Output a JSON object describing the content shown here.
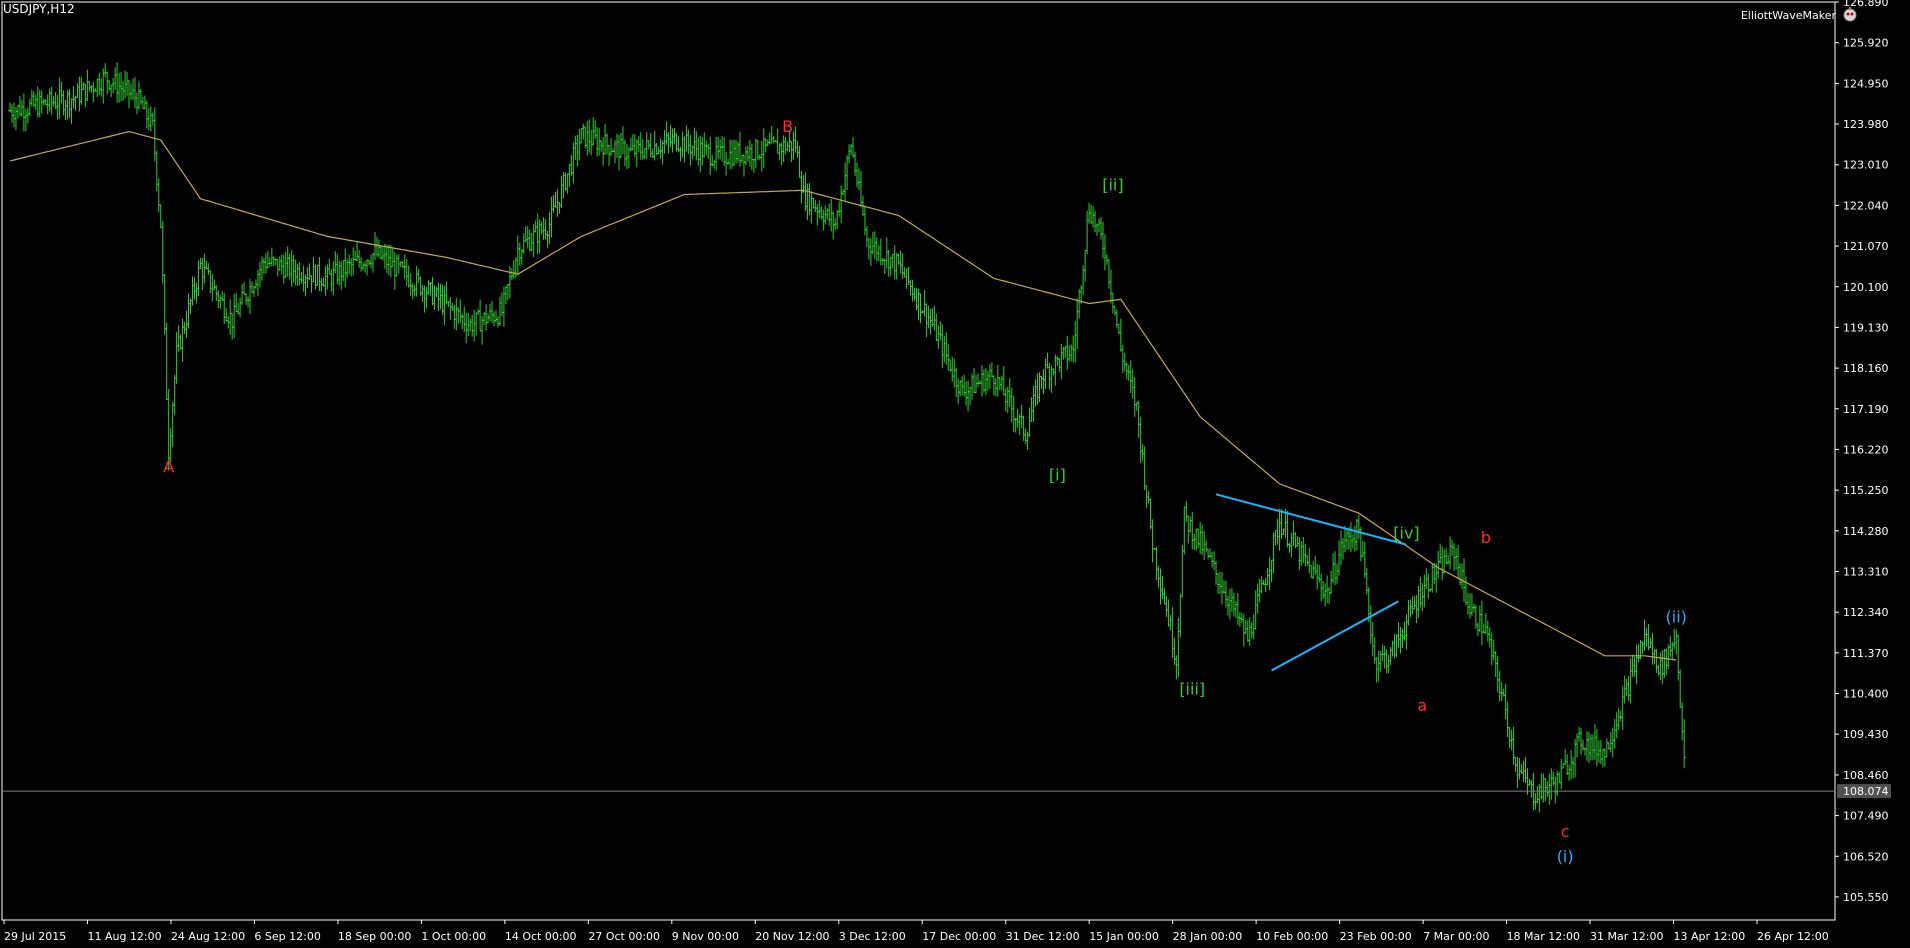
{
  "header": {
    "symbol_label": "USDJPY,H12",
    "indicator_label": "ElliottWaveMaker",
    "indicator_icon": "robot-icon"
  },
  "colors": {
    "background": "#000000",
    "bars": "#32cd32",
    "moving_average": "#c8a850",
    "triangle": "#19b4ff",
    "label_red": "#ff2b2b",
    "label_green": "#32cd32",
    "label_blue": "#19b4ff",
    "axis": "#ffffff",
    "price_line": "#808080"
  },
  "chart_data": {
    "type": "ohlc",
    "timeframe": "H12",
    "ylim": [
      105.0,
      126.89
    ],
    "y_ticks": [
      "126.890",
      "125.920",
      "124.950",
      "123.980",
      "123.010",
      "122.040",
      "121.070",
      "120.100",
      "119.130",
      "118.160",
      "117.190",
      "116.220",
      "115.250",
      "114.280",
      "113.310",
      "112.340",
      "111.370",
      "110.400",
      "109.430",
      "108.460",
      "107.490",
      "106.520",
      "105.550"
    ],
    "x_ticks": [
      "29 Jul 2015",
      "11 Aug 12:00",
      "24 Aug 12:00",
      "6 Sep 12:00",
      "18 Sep 00:00",
      "1 Oct 00:00",
      "14 Oct 00:00",
      "27 Oct 00:00",
      "9 Nov 00:00",
      "20 Nov 12:00",
      "3 Dec 12:00",
      "17 Dec 00:00",
      "31 Dec 12:00",
      "15 Jan 00:00",
      "28 Jan 00:00",
      "10 Feb 00:00",
      "23 Feb 00:00",
      "7 Mar 00:00",
      "18 Mar 12:00",
      "31 Mar 12:00",
      "13 Apr 12:00",
      "26 Apr 12:00"
    ],
    "bar_count": 230,
    "price_path": [
      [
        0,
        124.3
      ],
      [
        8,
        124.6
      ],
      [
        12,
        125.1
      ],
      [
        16,
        124.6
      ],
      [
        18,
        123.9
      ],
      [
        19,
        121.6
      ],
      [
        20,
        116.2
      ],
      [
        21,
        118.5
      ],
      [
        24,
        120.6
      ],
      [
        28,
        119.3
      ],
      [
        32,
        120.7
      ],
      [
        40,
        120.3
      ],
      [
        46,
        120.9
      ],
      [
        52,
        120.1
      ],
      [
        58,
        119.2
      ],
      [
        62,
        119.5
      ],
      [
        64,
        121.0
      ],
      [
        68,
        121.6
      ],
      [
        72,
        123.7
      ],
      [
        78,
        123.3
      ],
      [
        84,
        123.6
      ],
      [
        89,
        123.2
      ],
      [
        96,
        123.4
      ],
      [
        99,
        123.5
      ],
      [
        100,
        122.3
      ],
      [
        104,
        121.6
      ],
      [
        106,
        123.5
      ],
      [
        108,
        121.2
      ],
      [
        112,
        120.6
      ],
      [
        116,
        119.3
      ],
      [
        120,
        117.6
      ],
      [
        124,
        118.0
      ],
      [
        128,
        116.6
      ],
      [
        130,
        118.0
      ],
      [
        134,
        118.6
      ],
      [
        136,
        122.0
      ],
      [
        138,
        121.0
      ],
      [
        140,
        118.6
      ],
      [
        142,
        117.2
      ],
      [
        144,
        114.0
      ],
      [
        146,
        112.2
      ],
      [
        147,
        111.2
      ],
      [
        148,
        114.6
      ],
      [
        150,
        114.0
      ],
      [
        154,
        112.5
      ],
      [
        156,
        111.7
      ],
      [
        158,
        113.0
      ],
      [
        160,
        114.5
      ],
      [
        163,
        113.6
      ],
      [
        166,
        112.8
      ],
      [
        168,
        114.0
      ],
      [
        170,
        114.3
      ],
      [
        172,
        111.2
      ],
      [
        174,
        111.3
      ],
      [
        178,
        112.9
      ],
      [
        182,
        113.8
      ],
      [
        184,
        112.4
      ],
      [
        186,
        111.9
      ],
      [
        188,
        110.4
      ],
      [
        190,
        108.6
      ],
      [
        192,
        108.0
      ],
      [
        195,
        108.3
      ],
      [
        198,
        109.3
      ],
      [
        201,
        109.0
      ],
      [
        204,
        110.6
      ],
      [
        206,
        111.8
      ],
      [
        208,
        111.0
      ],
      [
        210,
        111.8
      ],
      [
        211,
        108.7
      ]
    ],
    "series": [
      {
        "kind": "moving_average",
        "points": [
          [
            0,
            123.1
          ],
          [
            15,
            123.8
          ],
          [
            19,
            123.6
          ],
          [
            24,
            122.2
          ],
          [
            40,
            121.3
          ],
          [
            55,
            120.8
          ],
          [
            64,
            120.4
          ],
          [
            72,
            121.3
          ],
          [
            85,
            122.3
          ],
          [
            100,
            122.4
          ],
          [
            112,
            121.8
          ],
          [
            124,
            120.3
          ],
          [
            136,
            119.7
          ],
          [
            140,
            119.8
          ],
          [
            150,
            117.0
          ],
          [
            160,
            115.4
          ],
          [
            170,
            114.7
          ],
          [
            180,
            113.4
          ],
          [
            190,
            112.4
          ],
          [
            201,
            111.3
          ],
          [
            206,
            111.3
          ],
          [
            210,
            111.2
          ]
        ]
      }
    ],
    "current_price": "108.074",
    "wave_labels": [
      {
        "text": "A",
        "bar": 20,
        "price": 116.3,
        "color": "label_red",
        "placement": "below"
      },
      {
        "text": "B",
        "bar": 98,
        "price": 123.7,
        "color": "label_red",
        "placement": "above"
      },
      {
        "text": "[i]",
        "bar": 132,
        "price": 116.1,
        "color": "label_green",
        "placement": "below"
      },
      {
        "text": "[ii]",
        "bar": 139,
        "price": 122.3,
        "color": "label_green",
        "placement": "above"
      },
      {
        "text": "[iii]",
        "bar": 149,
        "price": 111.0,
        "color": "label_green",
        "placement": "below"
      },
      {
        "text": "[iv]",
        "bar": 176,
        "price": 114.0,
        "color": "label_green",
        "placement": "above"
      },
      {
        "text": "a",
        "bar": 178,
        "price": 110.6,
        "color": "label_red",
        "placement": "below"
      },
      {
        "text": "b",
        "bar": 186,
        "price": 113.9,
        "color": "label_red",
        "placement": "above"
      },
      {
        "text": "c",
        "bar": 196,
        "price": 107.6,
        "color": "label_red",
        "placement": "below"
      },
      {
        "text": "(i)",
        "bar": 196,
        "price": 107.0,
        "color": "label_blue",
        "placement": "below"
      },
      {
        "text": "(ii)",
        "bar": 210,
        "price": 112.0,
        "color": "label_blue",
        "placement": "above"
      }
    ],
    "triangle": {
      "upper": [
        [
          152,
          115.15
        ],
        [
          176,
          113.95
        ]
      ],
      "lower": [
        [
          159,
          110.95
        ],
        [
          175,
          112.6
        ]
      ]
    }
  }
}
